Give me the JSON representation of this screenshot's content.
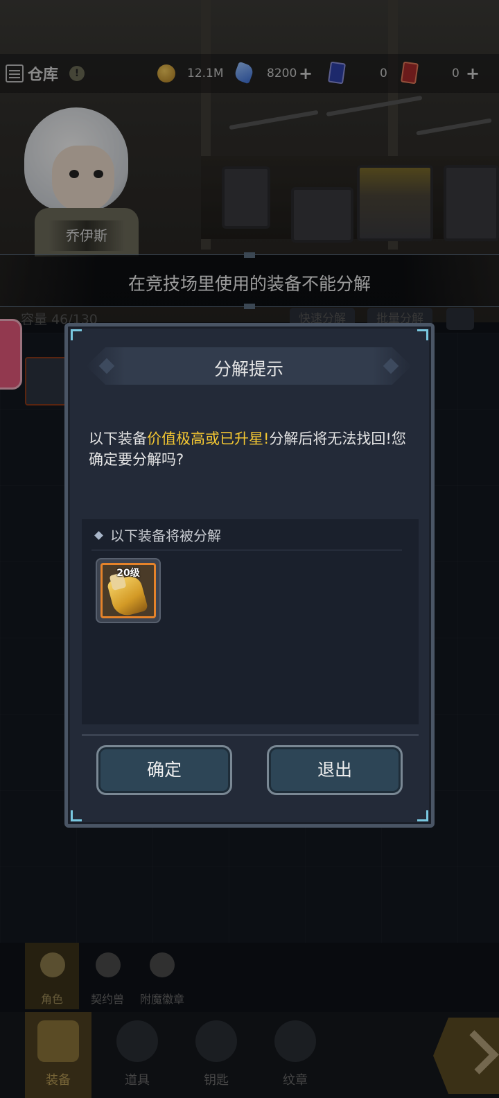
{
  "header": {
    "title": "仓库",
    "help_icon_text": "!",
    "gold": "12.1M",
    "gems": "8200",
    "blue_tickets": "0",
    "red_tickets": "0"
  },
  "character": {
    "name": "乔伊斯"
  },
  "toast": {
    "message": "在竞技场里使用的装备不能分解"
  },
  "inventory": {
    "capacity": "容量 46/130",
    "quick_decompose": "快速分解",
    "batch_decompose": "批量分解"
  },
  "dialog": {
    "title": "分解提示",
    "message_before": "以下装备",
    "message_highlight": "价值极高或已升星!",
    "message_after": "分解后将无法找回!您确定要分解吗?",
    "list_header": "以下装备将被分解",
    "items": [
      {
        "level": "20级",
        "icon": "gauntlet-icon",
        "rarity_color": "#e5832a"
      }
    ],
    "confirm_label": "确定",
    "exit_label": "退出",
    "highlight_color": "#f5c832"
  },
  "subtabs": [
    {
      "label": "角色",
      "icon": "character-icon",
      "active": true
    },
    {
      "label": "契约兽",
      "icon": "paw-icon",
      "active": false
    },
    {
      "label": "附魔徽章",
      "icon": "enchant-badge-icon",
      "active": false
    }
  ],
  "nav": [
    {
      "label": "装备",
      "icon": "equipment-icon",
      "active": true
    },
    {
      "label": "道具",
      "icon": "chest-icon",
      "active": false
    },
    {
      "label": "钥匙",
      "icon": "key-icon",
      "active": false
    },
    {
      "label": "纹章",
      "icon": "crest-icon",
      "active": false
    }
  ]
}
